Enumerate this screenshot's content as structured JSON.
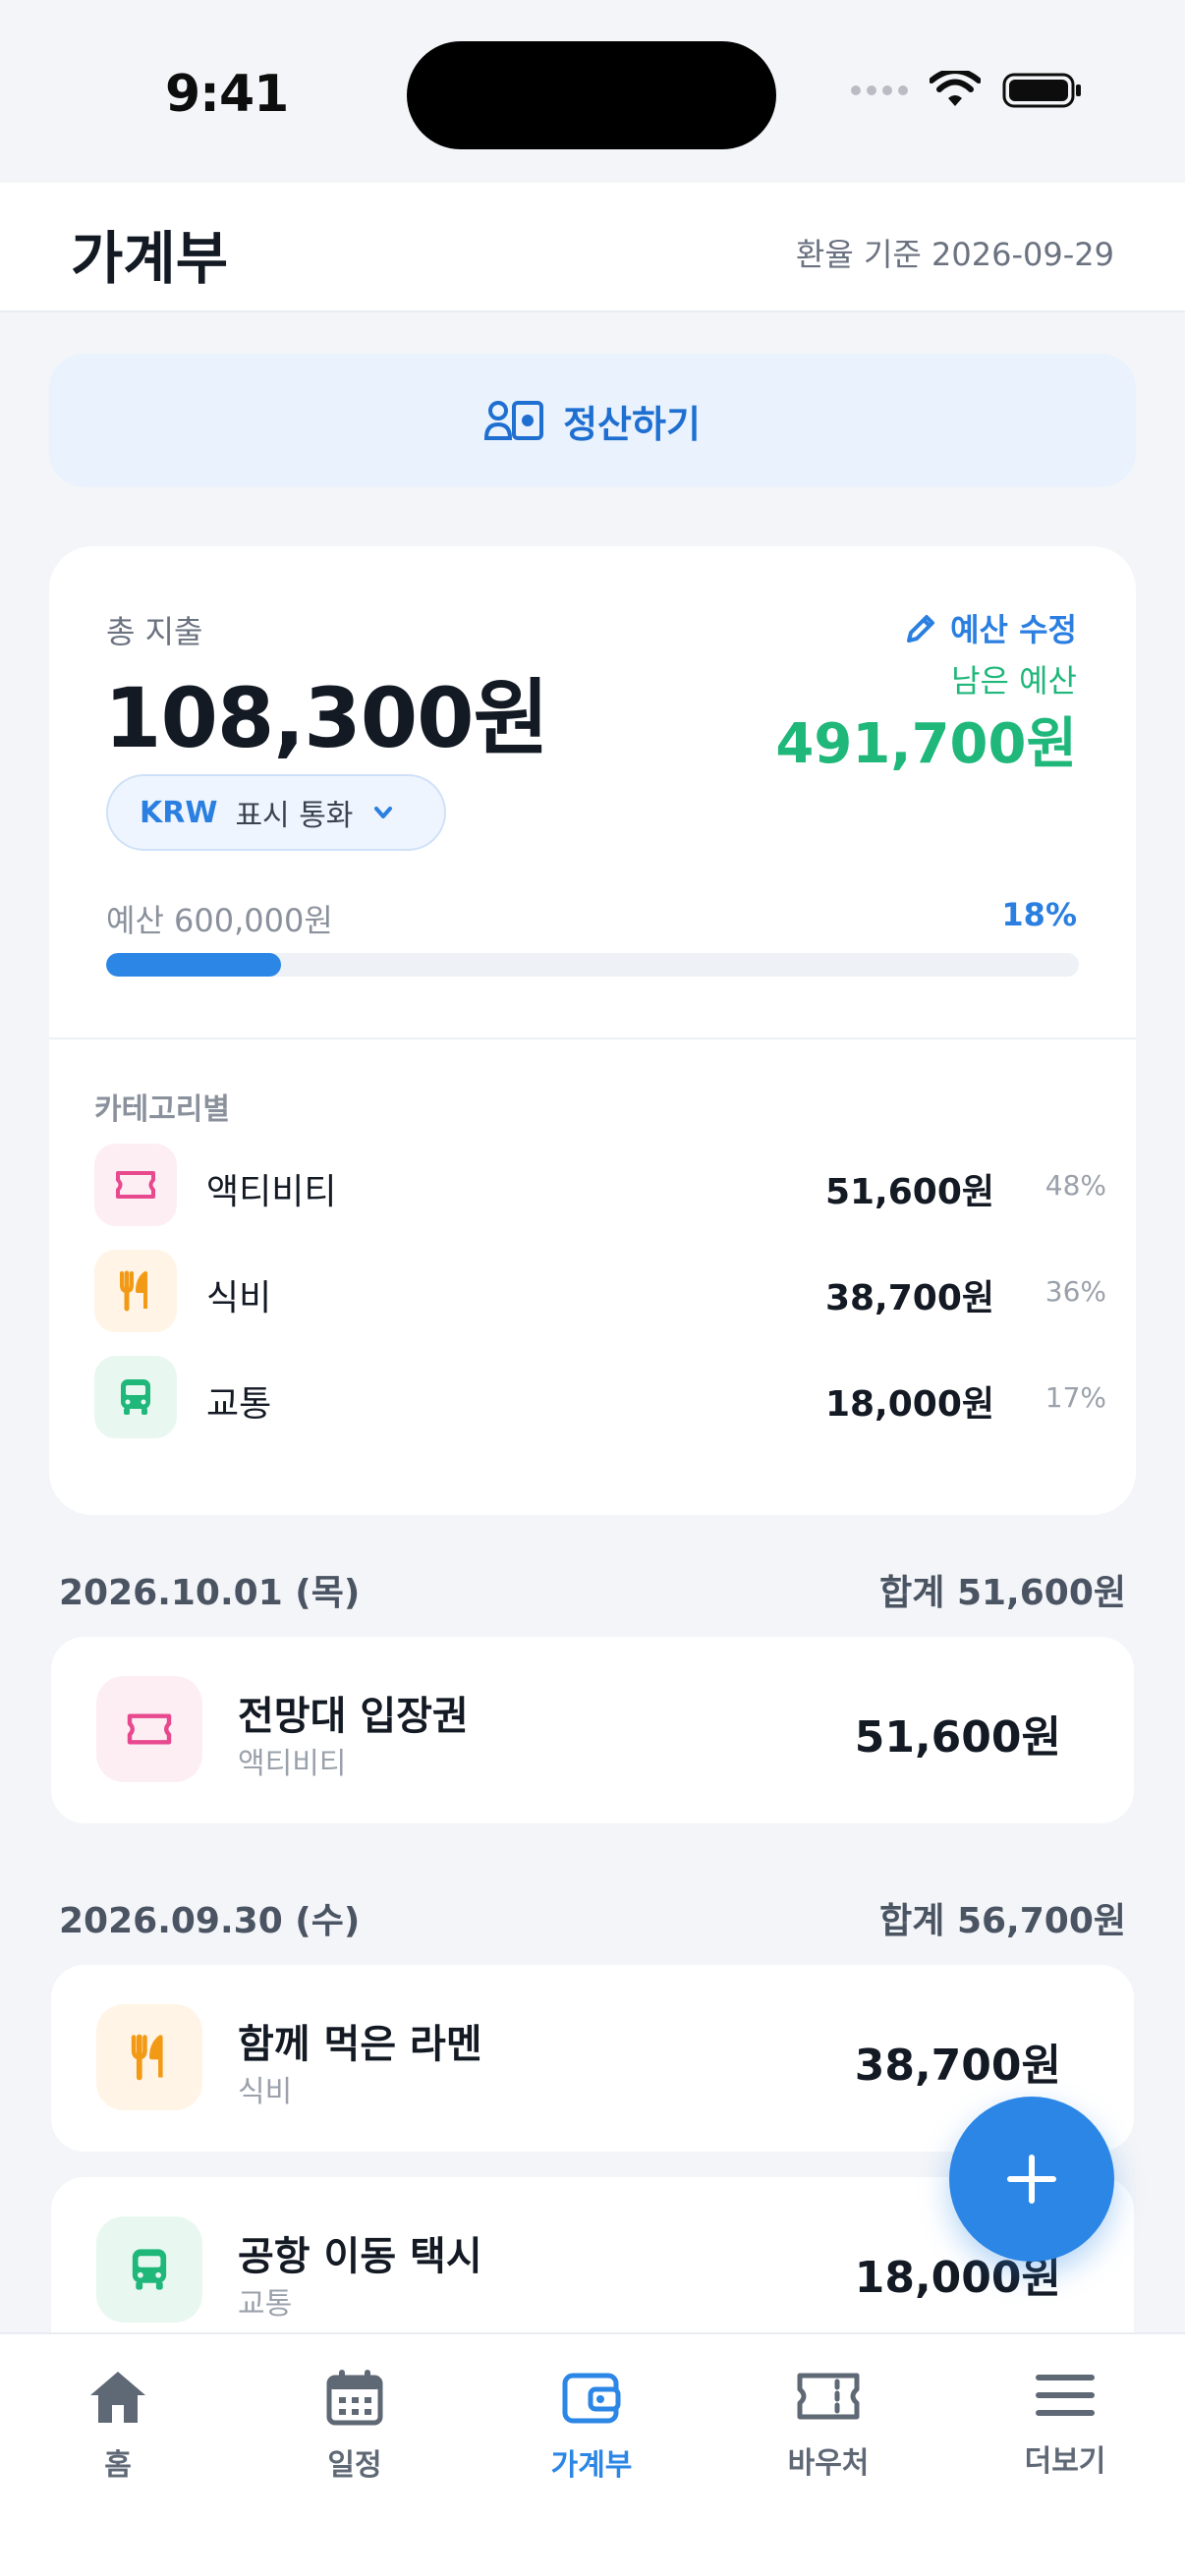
{
  "status_bar": {
    "time": "9:41"
  },
  "header": {
    "title": "가계부",
    "rate_note": "환율 기준 2026-09-29"
  },
  "settle_button": {
    "label": "정산하기"
  },
  "summary": {
    "total_label": "총 지출",
    "total_amount": "108,300원",
    "edit_budget_label": "예산 수정",
    "remaining_label": "남은 예산",
    "remaining_amount": "491,700원",
    "currency_code": "KRW",
    "currency_label": "표시 통화",
    "budget_label": "예산 600,000원",
    "budget_percent": "18%",
    "budget_progress": 0.18,
    "categories_heading": "카테고리별",
    "categories": [
      {
        "name": "액티비티",
        "amount": "51,600원",
        "percent": "48%",
        "icon": "ticket-icon",
        "color": "#e8498e",
        "bg": "#fdeef4"
      },
      {
        "name": "식비",
        "amount": "38,700원",
        "percent": "36%",
        "icon": "fork-knife-icon",
        "color": "#f29a16",
        "bg": "#fff4e5"
      },
      {
        "name": "교통",
        "amount": "18,000원",
        "percent": "17%",
        "icon": "bus-icon",
        "color": "#1fb77a",
        "bg": "#e8f8f0"
      }
    ]
  },
  "days": [
    {
      "date": "2026.10.01 (목)",
      "total": "합계 51,600원",
      "transactions": [
        {
          "title": "전망대 입장권",
          "category": "액티비티",
          "amount": "51,600원"
        }
      ]
    },
    {
      "date": "2026.09.30 (수)",
      "total": "합계 56,700원",
      "transactions": [
        {
          "title": "함께 먹은 라멘",
          "category": "식비",
          "amount": "38,700원"
        },
        {
          "title": "공항 이동 택시",
          "category": "교통",
          "amount": "18,000원"
        }
      ]
    }
  ],
  "tabs": [
    {
      "label": "홈",
      "icon": "home-icon",
      "active": false
    },
    {
      "label": "일정",
      "icon": "calendar-icon",
      "active": false
    },
    {
      "label": "가계부",
      "icon": "wallet-icon",
      "active": true
    },
    {
      "label": "바우처",
      "icon": "voucher-icon",
      "active": false
    },
    {
      "label": "더보기",
      "icon": "menu-icon",
      "active": false
    }
  ],
  "colors": {
    "accent": "#2b86e6",
    "positive": "#1fb77a"
  }
}
